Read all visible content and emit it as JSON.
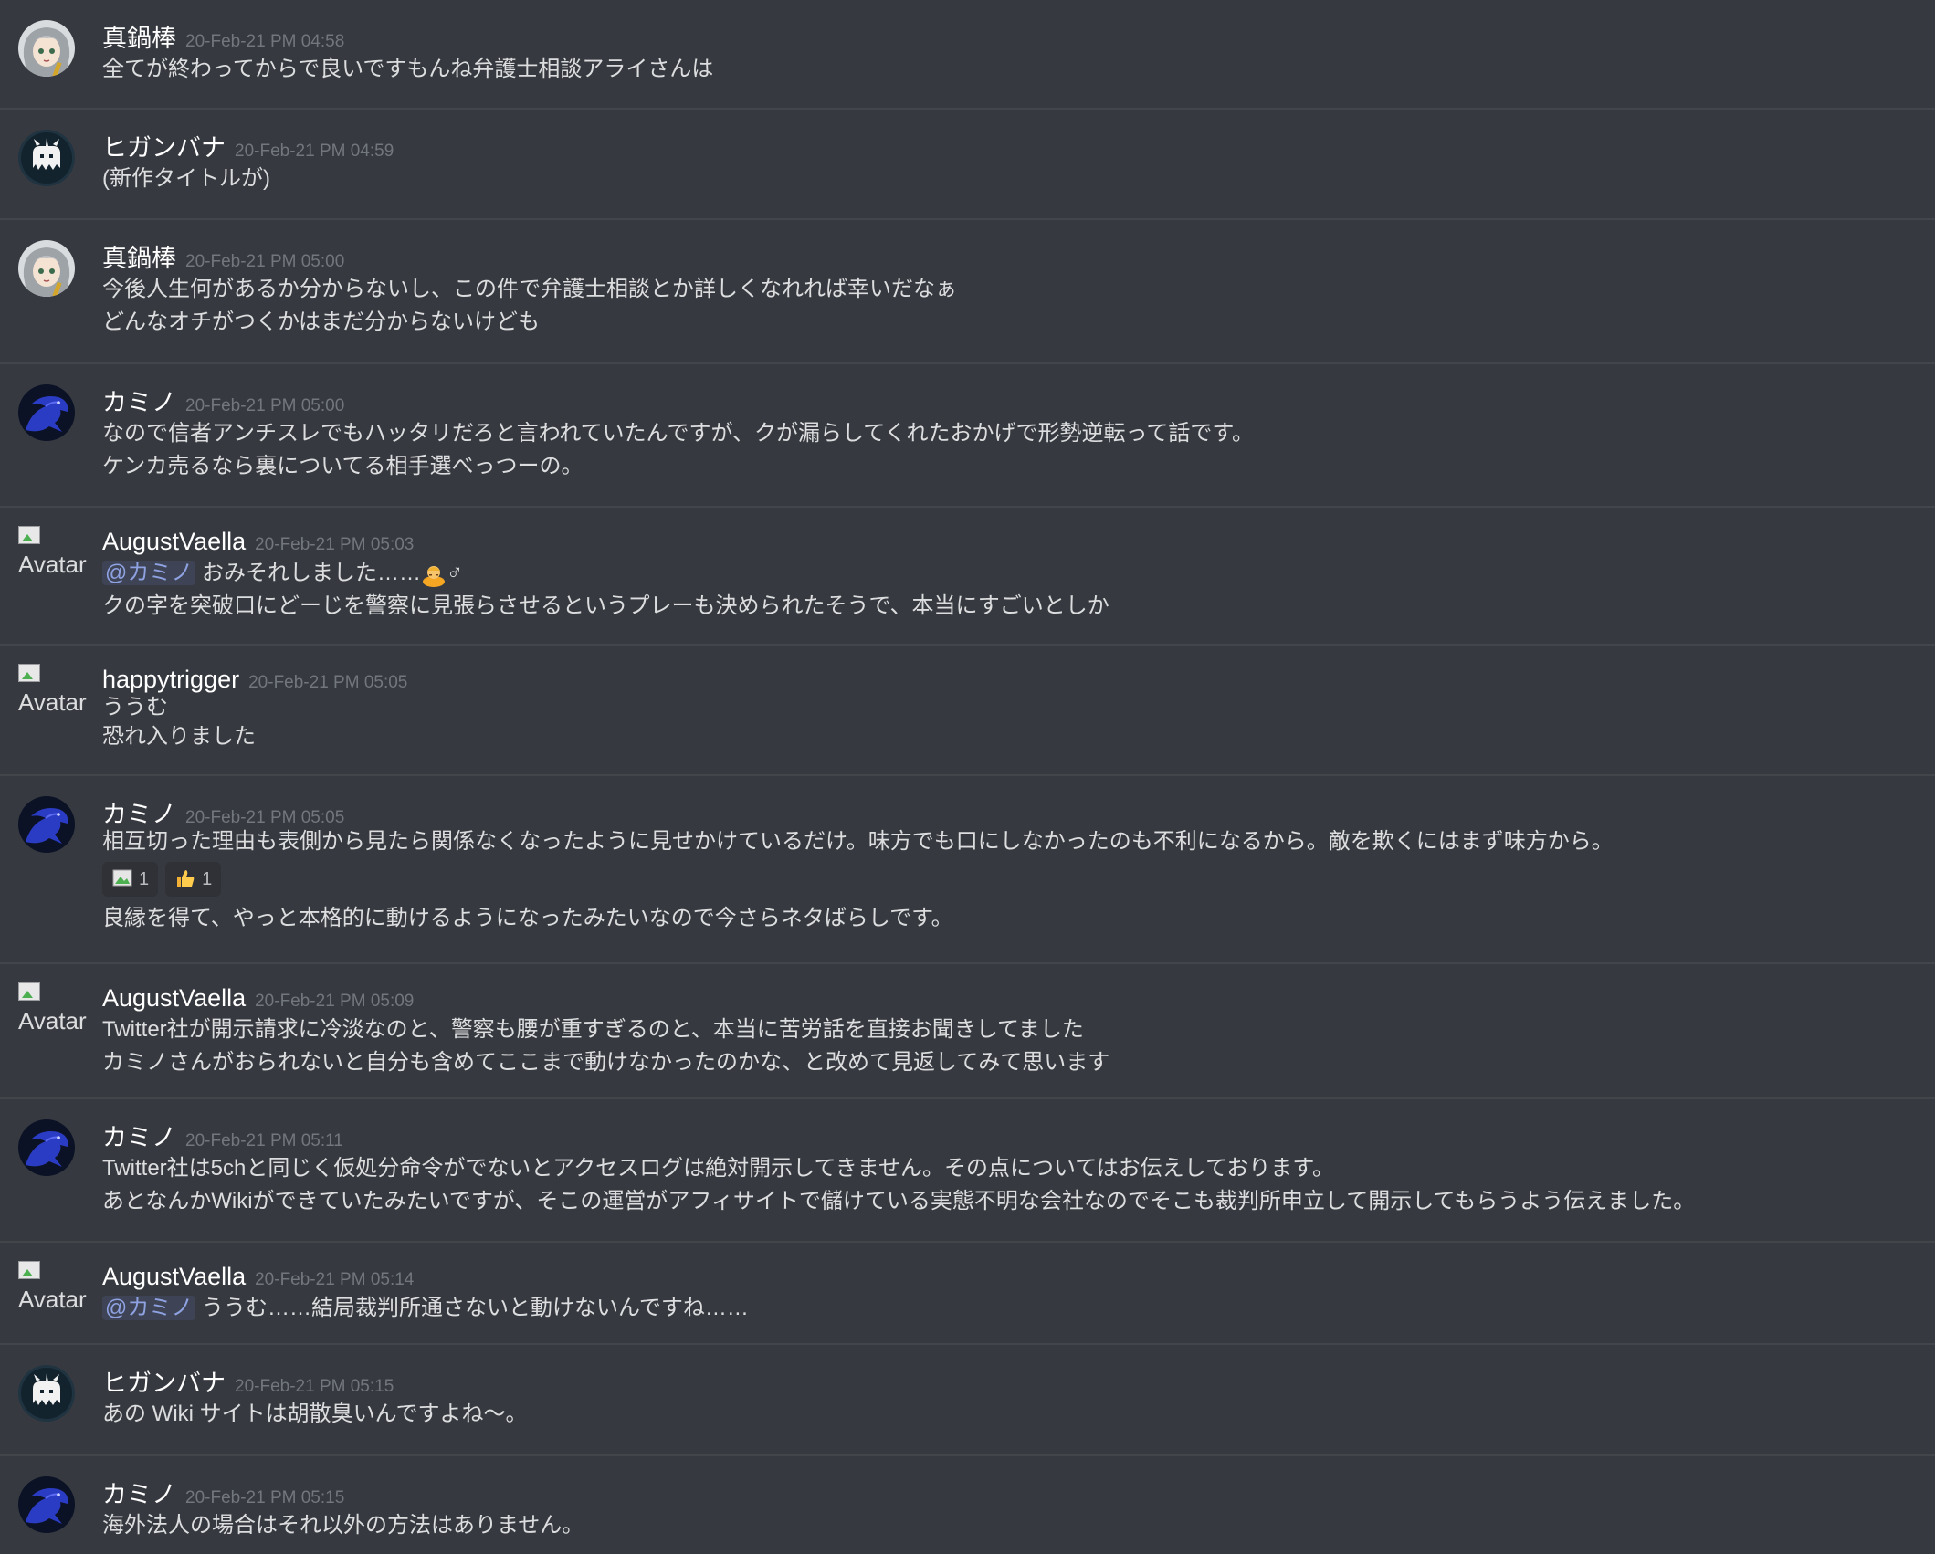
{
  "colors": {
    "background": "#36393f",
    "divider": "#42454a",
    "username": "#ffffff",
    "timestamp": "#72767d",
    "text": "#dcddde",
    "mention": "#8ea1e1"
  },
  "broken_avatar_alt": "Avatar",
  "messages": [
    {
      "author": "真鍋棒",
      "timestamp": "20-Feb-21 PM 04:58",
      "avatar": "anime-girl-avatar-icon",
      "lines": [
        "全てが終わってからで良いですもんね弁護士相談アライさんは"
      ]
    },
    {
      "author": "ヒガンバナ",
      "timestamp": "20-Feb-21 PM 04:59",
      "avatar": "white-creature-avatar-icon",
      "lines": [
        "(新作タイトルが)"
      ]
    },
    {
      "author": "真鍋棒",
      "timestamp": "20-Feb-21 PM 05:00",
      "avatar": "anime-girl-avatar-icon",
      "lines": [
        "今後人生何があるか分からないし、この件で弁護士相談とか詳しくなれれば幸いだなぁ",
        "どんなオチがつくかはまだ分からないけども"
      ]
    },
    {
      "author": "カミノ",
      "timestamp": "20-Feb-21 PM 05:00",
      "avatar": "blue-dragon-avatar-icon",
      "lines": [
        "なので信者アンチスレでもハッタリだろと言われていたんですが、クが漏らしてくれたおかげで形勢逆転って話です。",
        "ケンカ売るなら裏についてる相手選べっつーの。"
      ]
    },
    {
      "author": "AugustVaella",
      "timestamp": "20-Feb-21 PM 05:03",
      "mention": "@カミノ",
      "line1_after_mention": " おみそれしました……",
      "line1_emoji": "person-bowing-emoji",
      "line1_symbol": "♂",
      "line2": "クの字を突破口にどーじを警察に見張らさせるというプレーも決められたそうで、本当にすごいとしか"
    },
    {
      "author": "happytrigger",
      "timestamp": "20-Feb-21 PM 05:05",
      "lines": [
        "ううむ",
        "恐れ入りました"
      ]
    },
    {
      "author": "カミノ",
      "timestamp": "20-Feb-21 PM 05:05",
      "avatar": "blue-dragon-avatar-icon",
      "line1": "相互切った理由も表側から見たら関係なくなったように見せかけているだけ。味方でも口にしなかったのも不利になるから。敵を欺くにはまず味方から。",
      "reactions": [
        {
          "icon": "broken-image-icon",
          "count": "1"
        },
        {
          "icon": "thumbs-up-icon",
          "count": "1"
        }
      ],
      "line2": "良縁を得て、やっと本格的に動けるようになったみたいなので今さらネタばらしです。"
    },
    {
      "author": "AugustVaella",
      "timestamp": "20-Feb-21 PM 05:09",
      "lines": [
        "Twitter社が開示請求に冷淡なのと、警察も腰が重すぎるのと、本当に苦労話を直接お聞きしてました",
        "カミノさんがおられないと自分も含めてここまで動けなかったのかな、と改めて見返してみて思います"
      ]
    },
    {
      "author": "カミノ",
      "timestamp": "20-Feb-21 PM 05:11",
      "avatar": "blue-dragon-avatar-icon",
      "lines": [
        "Twitter社は5chと同じく仮処分命令がでないとアクセスログは絶対開示してきません。その点についてはお伝えしております。",
        "あとなんかWikiができていたみたいですが、そこの運営がアフィサイトで儲けている実態不明な会社なのでそこも裁判所申立して開示してもらうよう伝えました。"
      ]
    },
    {
      "author": "AugustVaella",
      "timestamp": "20-Feb-21 PM 05:14",
      "mention": "@カミノ",
      "line1_after_mention": " ううむ……結局裁判所通さないと動けないんですね……"
    },
    {
      "author": "ヒガンバナ",
      "timestamp": "20-Feb-21 PM 05:15",
      "avatar": "white-creature-avatar-icon",
      "lines": [
        "あの Wiki サイトは胡散臭いんですよね～。"
      ]
    },
    {
      "author": "カミノ",
      "timestamp": "20-Feb-21 PM 05:15",
      "avatar": "blue-dragon-avatar-icon",
      "lines": [
        "海外法人の場合はそれ以外の方法はありません。"
      ]
    }
  ]
}
